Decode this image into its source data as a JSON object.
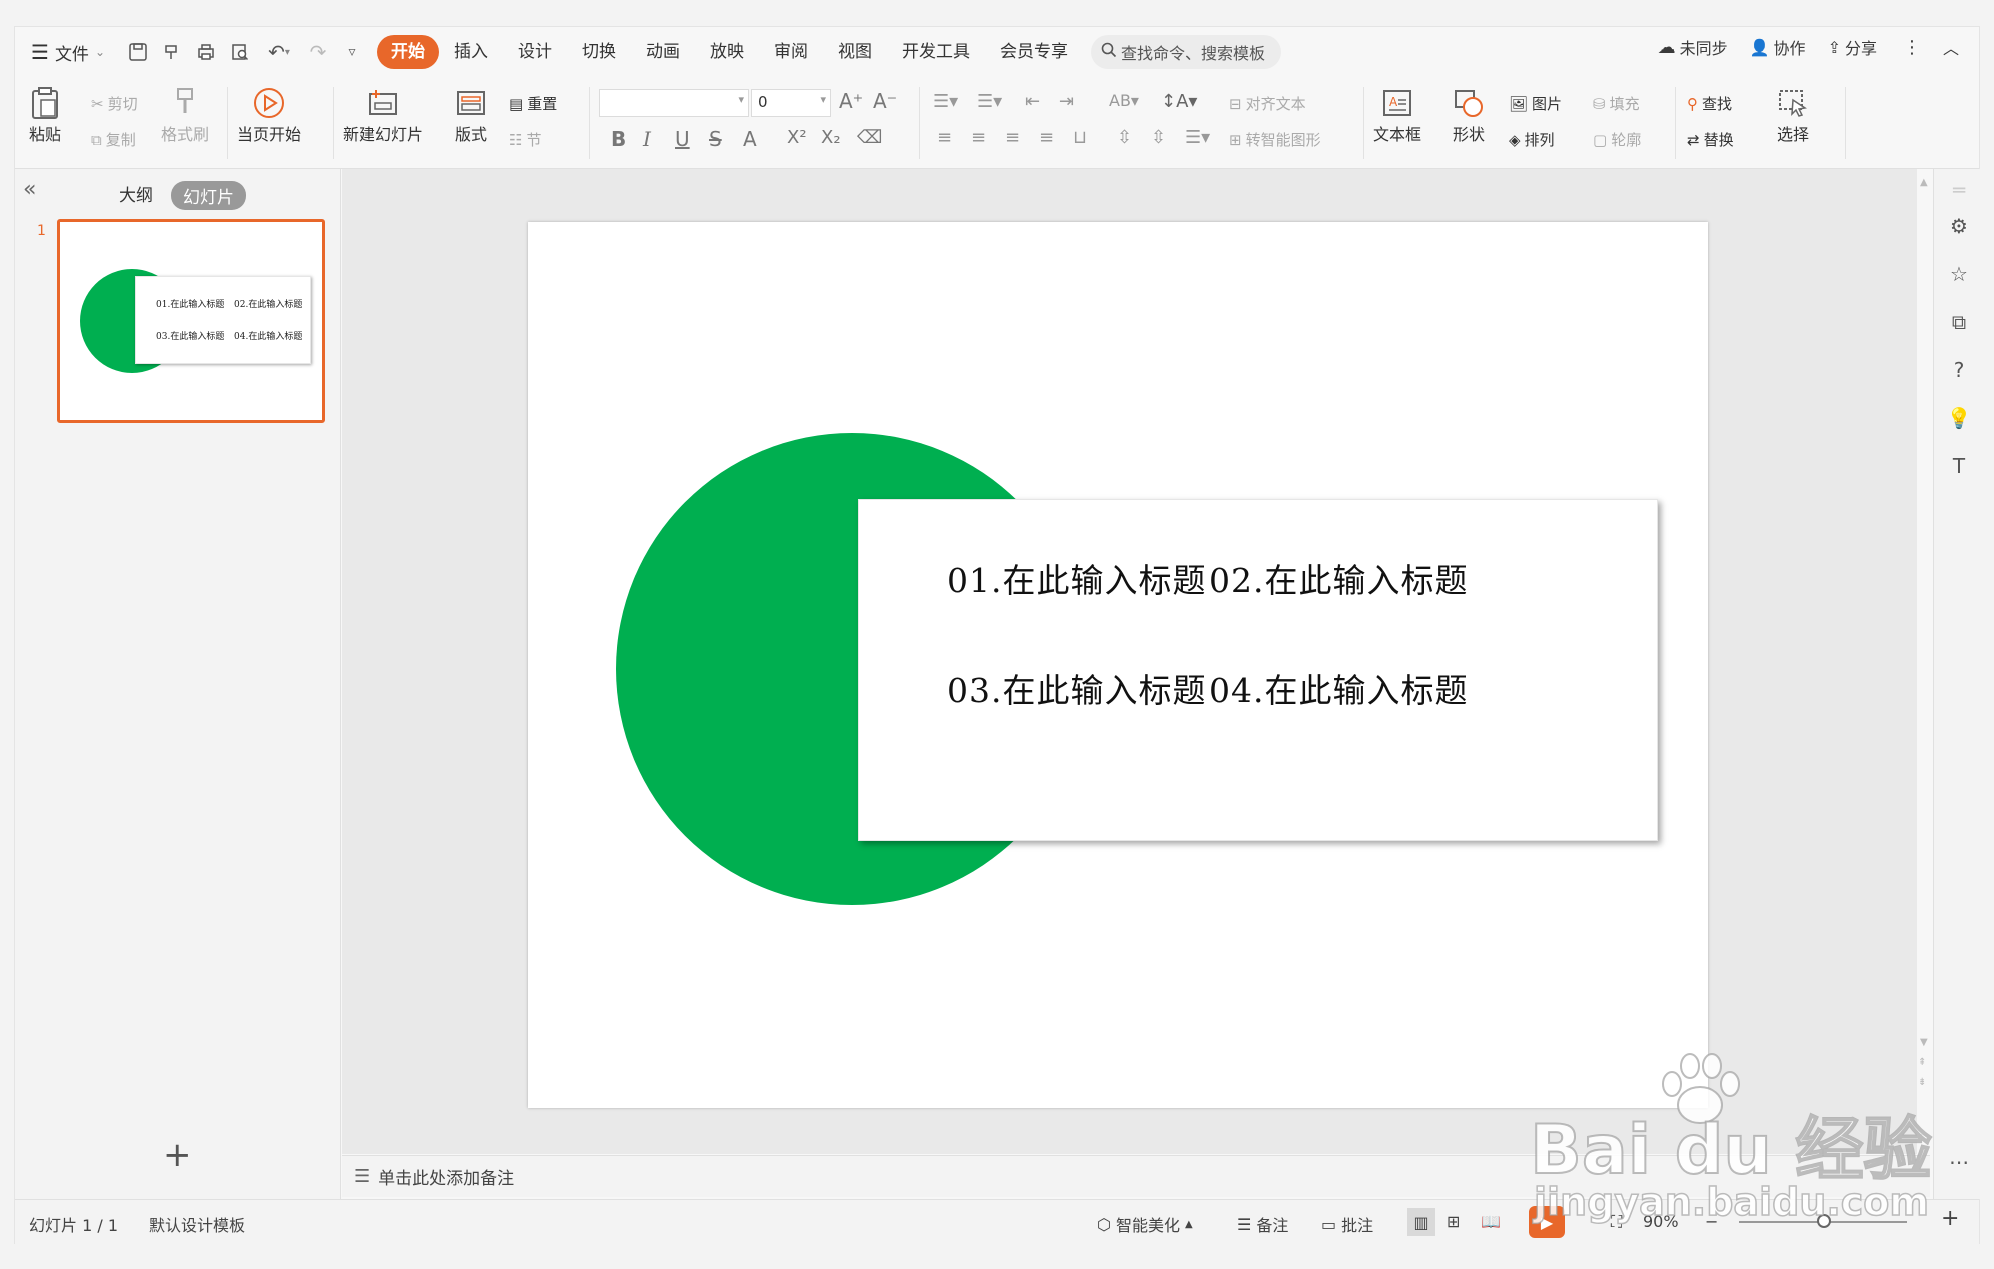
{
  "menu": {
    "file_label": "文件",
    "tabs": [
      "开始",
      "插入",
      "设计",
      "切换",
      "动画",
      "放映",
      "审阅",
      "视图",
      "开发工具",
      "会员专享"
    ],
    "active_tab": "开始",
    "search_placeholder": "查找命令、搜索模板",
    "unsynced": "未同步",
    "collaborate": "协作",
    "share": "分享"
  },
  "ribbon": {
    "paste": "粘贴",
    "cut": "剪切",
    "copy": "复制",
    "format_painter": "格式刷",
    "from_current": "当页开始",
    "new_slide": "新建幻灯片",
    "layout": "版式",
    "reset": "重置",
    "section": "节",
    "font_name": "",
    "font_size": "0",
    "align_text": "对齐文本",
    "smart_shape": "转智能图形",
    "textbox": "文本框",
    "shape": "形状",
    "picture": "图片",
    "arrange": "排列",
    "fill": "填充",
    "outline": "轮廓",
    "find": "查找",
    "replace": "替换",
    "select": "选择"
  },
  "panel": {
    "outline_tab": "大纲",
    "slides_tab": "幻灯片",
    "slide_number": "1"
  },
  "slide": {
    "items": [
      "01.在此输入标题",
      "02.在此输入标题",
      "03.在此输入标题",
      "04.在此输入标题"
    ],
    "circle_color": "#00af50"
  },
  "notes_placeholder": "单击此处添加备注",
  "status": {
    "slide_counter": "幻灯片 1 / 1",
    "template": "默认设计模板",
    "beautify": "智能美化",
    "notes": "备注",
    "comments": "批注",
    "zoom": "90%"
  },
  "watermark": {
    "brand": "Bai du 经验",
    "url": "jingyan.baidu.com"
  },
  "colors": {
    "accent": "#e8672a",
    "green": "#00af50"
  }
}
